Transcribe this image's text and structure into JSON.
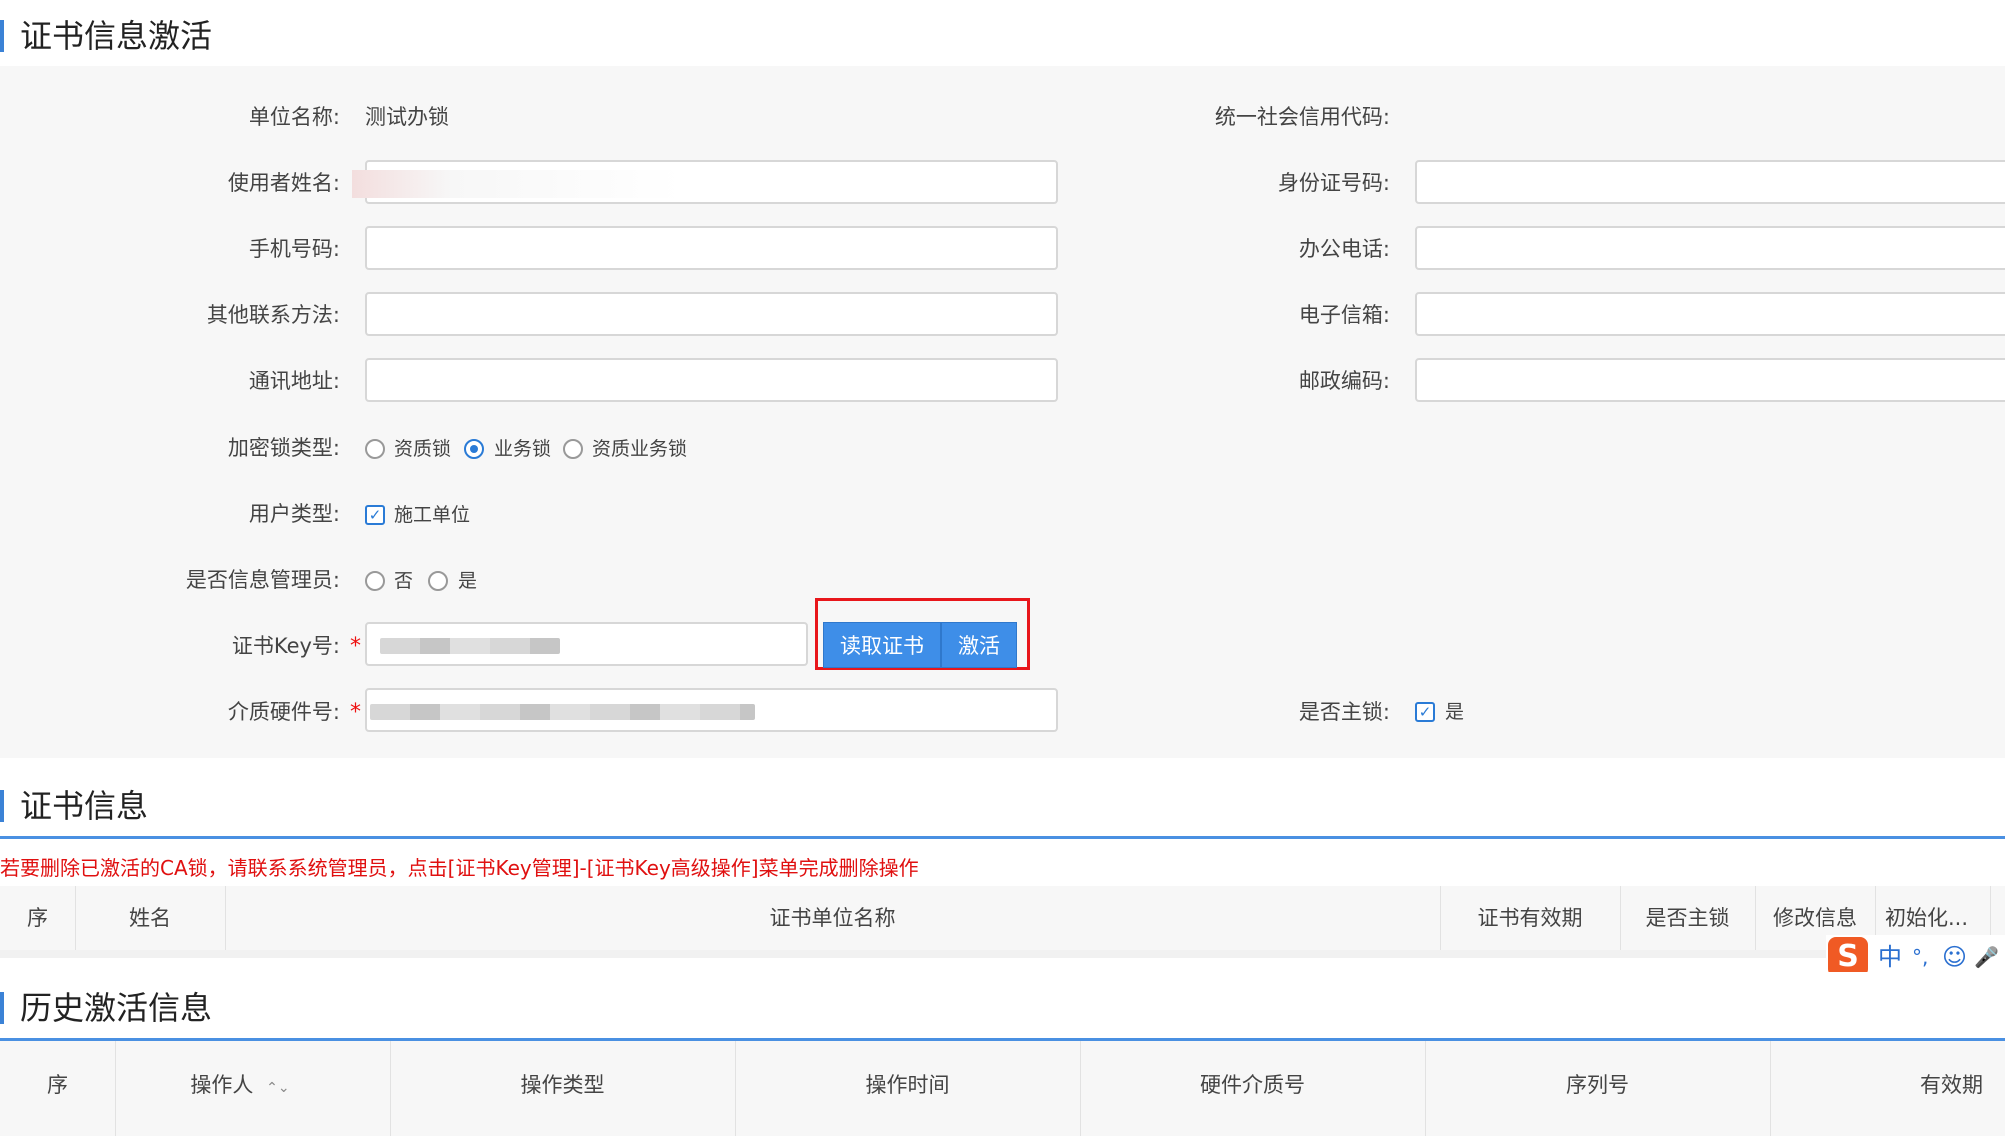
{
  "sections": {
    "activation_title": "证书信息激活",
    "cert_info_title": "证书信息",
    "history_title": "历史激活信息"
  },
  "form": {
    "unit_name_label": "单位名称:",
    "unit_name_value": "测试办锁",
    "credit_code_label": "统一社会信用代码:",
    "user_name_label": "使用者姓名:",
    "id_number_label": "身份证号码:",
    "mobile_label": "手机号码:",
    "office_phone_label": "办公电话:",
    "other_contact_label": "其他联系方法:",
    "email_label": "电子信箱:",
    "address_label": "通讯地址:",
    "postcode_label": "邮政编码:",
    "lock_type_label": "加密锁类型:",
    "lock_type_options": [
      "资质锁",
      "业务锁",
      "资质业务锁"
    ],
    "lock_type_selected": "业务锁",
    "user_type_label": "用户类型:",
    "user_type_option": "施工单位",
    "is_admin_label": "是否信息管理员:",
    "is_admin_options": [
      "否",
      "是"
    ],
    "cert_key_label": "证书Key号:",
    "hardware_no_label": "介质硬件号:",
    "required_mark": "*",
    "is_main_lock_label": "是否主锁:",
    "is_main_lock_option": "是",
    "read_cert_button": "读取证书",
    "activate_button": "激活"
  },
  "cert_info": {
    "warning": "若要删除已激活的CA锁，请联系系统管理员，点击[证书Key管理]-[证书Key高级操作]菜单完成删除操作",
    "columns": [
      "序",
      "姓名",
      "证书单位名称",
      "证书有效期",
      "是否主锁",
      "修改信息",
      "初始化..."
    ]
  },
  "history": {
    "columns": [
      "序",
      "操作人",
      "操作类型",
      "操作时间",
      "硬件介质号",
      "序列号",
      "有效期"
    ],
    "sort_icon": "⌃⌄"
  },
  "ime": {
    "logo": "S",
    "items": [
      "中",
      "°,",
      "☺",
      "🎤"
    ]
  },
  "colors": {
    "accent": "#3e8ee8",
    "highlight": "#e8161b",
    "warning_text": "#e01010"
  }
}
